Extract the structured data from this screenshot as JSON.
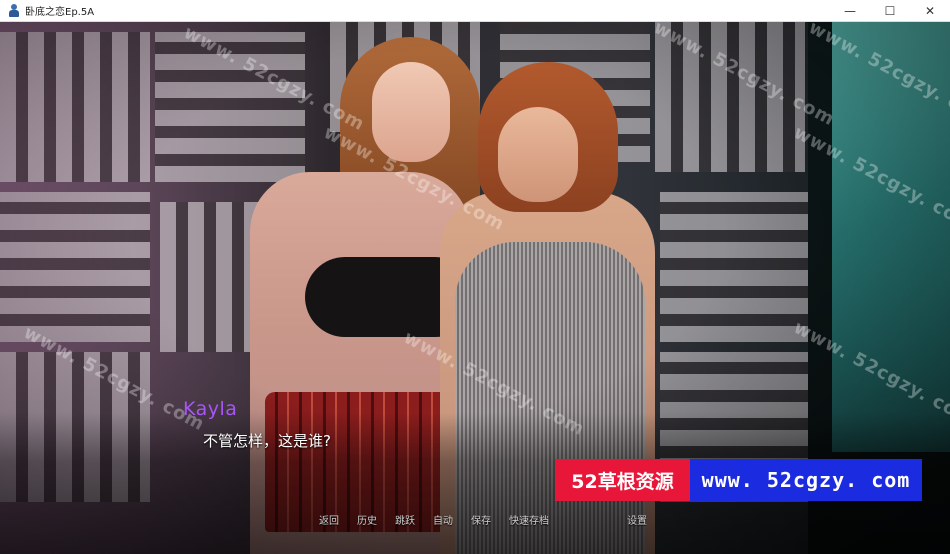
{
  "window": {
    "title": "卧底之恋Ep.5A",
    "minimize_glyph": "—",
    "maximize_glyph": "☐",
    "close_glyph": "✕"
  },
  "dialogue": {
    "speaker": "Kayla",
    "speaker_color": "#a855f7",
    "text": "不管怎样，这是谁?"
  },
  "quick_menu": [
    "返回",
    "历史",
    "跳跃",
    "自动",
    "保存",
    "快速存档",
    "",
    "设置"
  ],
  "watermark": {
    "banner_left": "52草根资源",
    "banner_right": "www. 52cgzy. com",
    "banner_left_color": "#e8173a",
    "banner_right_color": "#1a2be0",
    "diagonal_text": "www. 52cgzy. com"
  }
}
